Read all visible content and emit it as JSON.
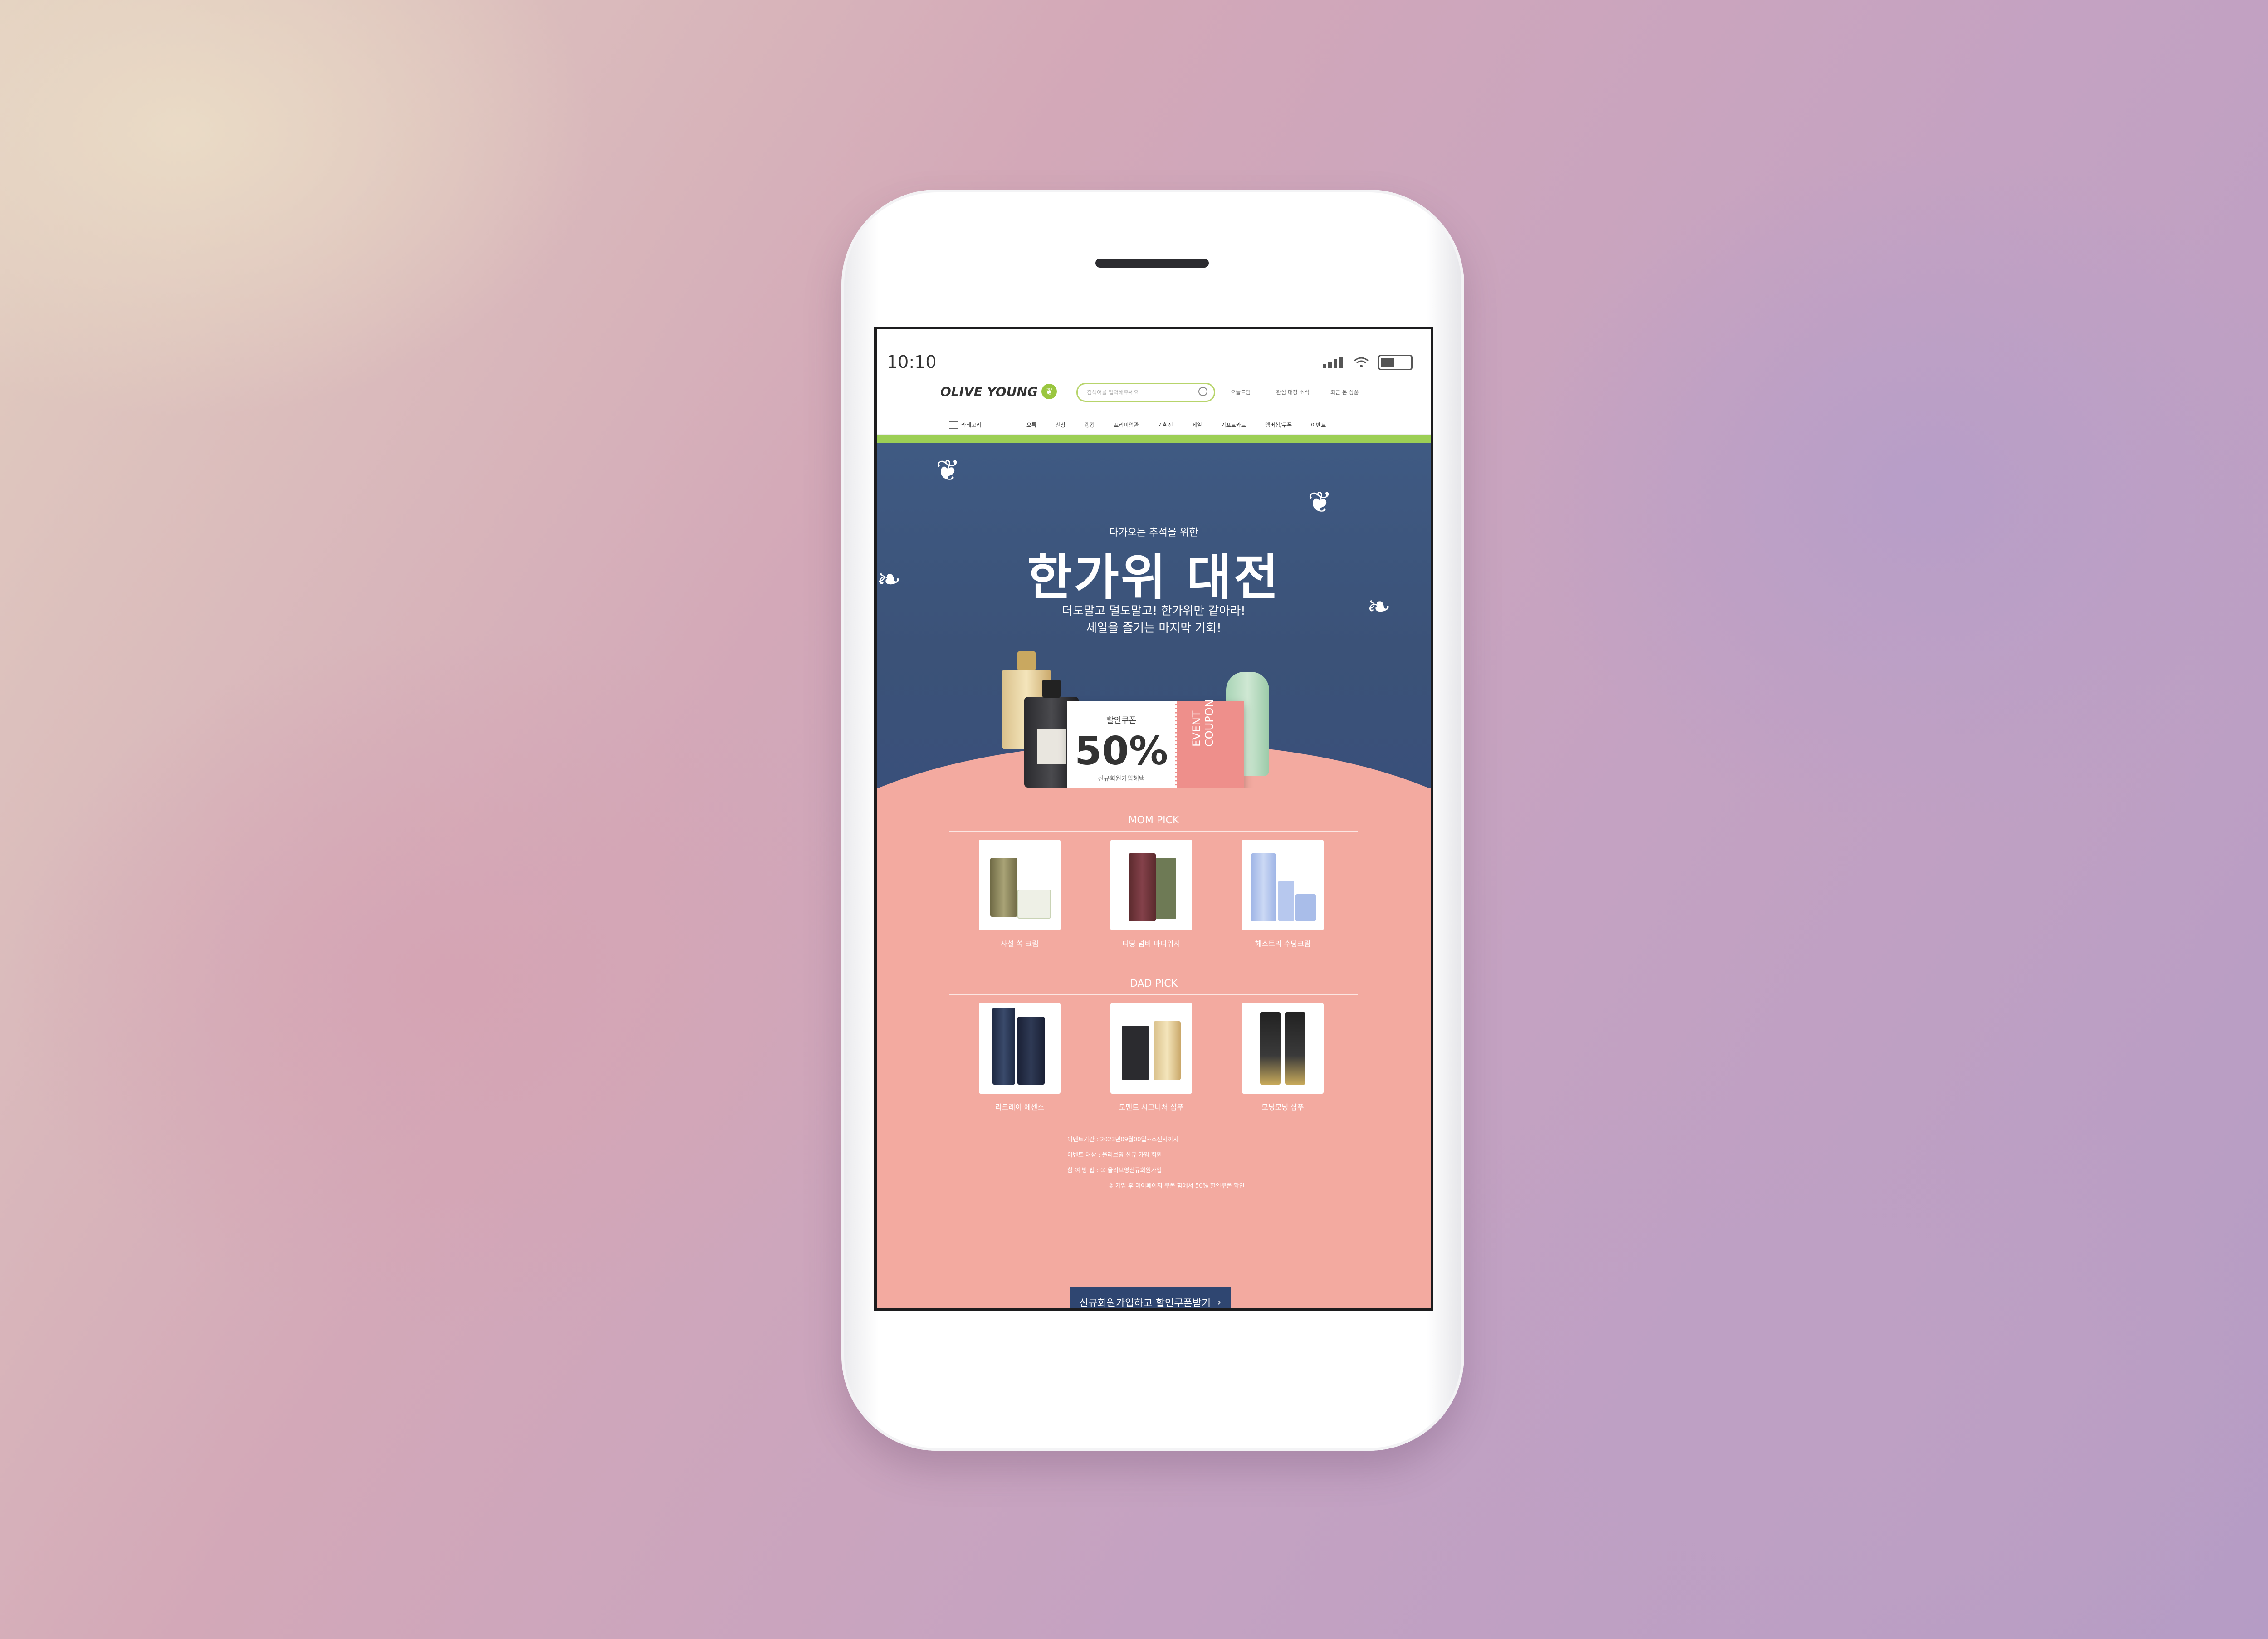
{
  "status_bar": {
    "time": "10:10"
  },
  "header": {
    "logo_text": "OLIVE YOUNG",
    "search_placeholder": "검색어를 입력해주세요",
    "util_links": [
      "오늘드림",
      "관심 매장 소식",
      "최근 본 상품"
    ]
  },
  "nav": {
    "category_label": "카테고리",
    "items": [
      "오특",
      "신상",
      "랭킹",
      "프리미엄관",
      "기획전",
      "세일",
      "기프트카드",
      "멤버십/쿠폰",
      "이벤트"
    ]
  },
  "banner": {
    "subtitle": "다가오는 추석을 위한",
    "title": "한가위 대전",
    "copy_line1": "더도말고 덜도말고! 한가위만 같아라!",
    "copy_line2": "세일을 즐기는 마지막 기회!",
    "coupon": {
      "label": "할인쿠폰",
      "percent": "50%",
      "desc": "신규회원가입혜택",
      "side_text_line1": "EVENT",
      "side_text_line2": "COUPON"
    }
  },
  "mom_pick": {
    "title": "MOM PICK",
    "products": [
      {
        "name": "사설 쏙 크림"
      },
      {
        "name": "티딩 넘버 바디워시"
      },
      {
        "name": "헤스트리 수딩크림"
      }
    ]
  },
  "dad_pick": {
    "title": "DAD PICK",
    "products": [
      {
        "name": "리크레이 에센스"
      },
      {
        "name": "모멘트 시그니처 샴푸"
      },
      {
        "name": "모닝모닝 샴푸"
      }
    ]
  },
  "notes": {
    "line1": "이벤트기간 : 2023년09월00일~소진시까지",
    "line2": "이벤트 대상 : 올리브영 신규 가입 회원",
    "line3": "참 여 방 법 : ① 올리브영신규회원가입",
    "line4": "② 가입 후 마이페이지 쿠폰 함에서 50% 할인쿠폰 확인"
  },
  "cta": {
    "label": "신규회원가입하고 할인쿠폰받기",
    "arrow": "›"
  },
  "colors": {
    "banner_navy": "#3f5a83",
    "pink": "#f3aaa0",
    "accent_green": "#9ccf55",
    "coupon_coral": "#ee8f8b",
    "cta_navy": "#2f4671"
  }
}
